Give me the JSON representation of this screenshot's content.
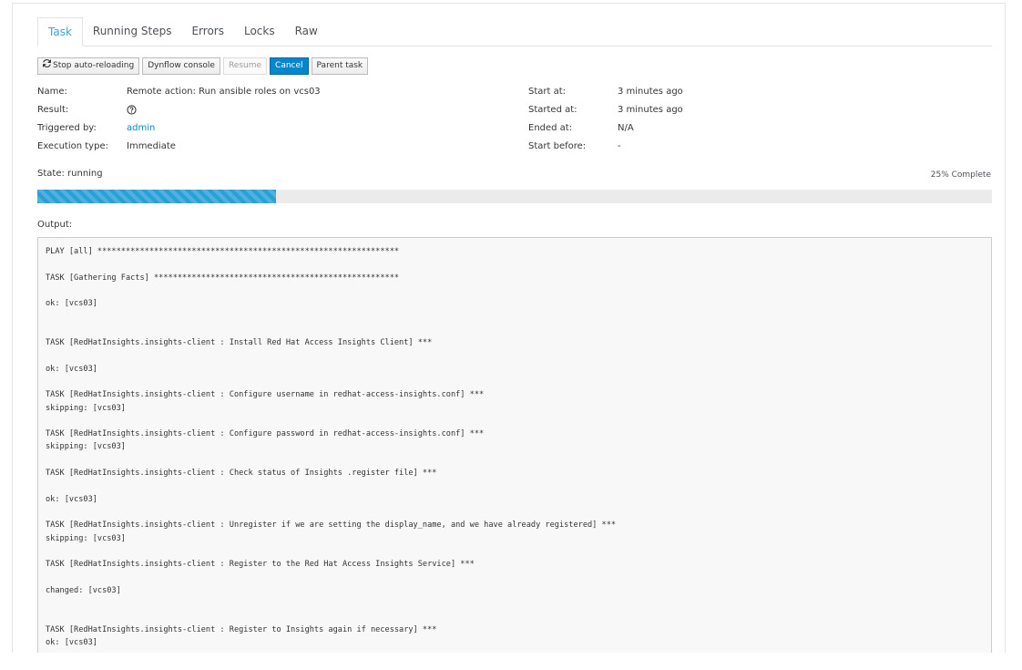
{
  "tabs": [
    {
      "label": "Task",
      "active": true
    },
    {
      "label": "Running Steps",
      "active": false
    },
    {
      "label": "Errors",
      "active": false
    },
    {
      "label": "Locks",
      "active": false
    },
    {
      "label": "Raw",
      "active": false
    }
  ],
  "toolbar": {
    "stop_auto_reloading": {
      "label": "Stop auto-reloading",
      "icon": "refresh-icon"
    },
    "dynflow_console": {
      "label": "Dynflow console"
    },
    "resume": {
      "label": "Resume",
      "disabled": true
    },
    "cancel": {
      "label": "Cancel",
      "primary": true
    },
    "parent_task": {
      "label": "Parent task"
    }
  },
  "details_left": {
    "name": {
      "label": "Name:",
      "value": "Remote action: Run ansible roles on vcs03"
    },
    "result": {
      "label": "Result:",
      "icon": "question-circle-icon"
    },
    "triggered_by": {
      "label": "Triggered by:",
      "value": "admin"
    },
    "execution_type": {
      "label": "Execution type:",
      "value": "Immediate"
    }
  },
  "details_right": {
    "start_at": {
      "label": "Start at:",
      "value": "3 minutes ago"
    },
    "started_at": {
      "label": "Started at:",
      "value": "3 minutes ago"
    },
    "ended_at": {
      "label": "Ended at:",
      "value": "N/A"
    },
    "start_before": {
      "label": "Start before:",
      "value": "-"
    }
  },
  "state": {
    "label": "State:",
    "value": "running"
  },
  "progress": {
    "percent": 25,
    "text": "25% Complete"
  },
  "colors": {
    "accent": "#0088ce",
    "progress_fill": "#2aa0d9",
    "tab_active": "#39a5dc"
  },
  "output": {
    "label": "Output:",
    "text": "PLAY [all] ****************************************************************\n\nTASK [Gathering Facts] ****************************************************\n\nok: [vcs03]\n\n\nTASK [RedHatInsights.insights-client : Install Red Hat Access Insights Client] ***\n\nok: [vcs03]\n\nTASK [RedHatInsights.insights-client : Configure username in redhat-access-insights.conf] ***\nskipping: [vcs03]\n\nTASK [RedHatInsights.insights-client : Configure password in redhat-access-insights.conf] ***\nskipping: [vcs03]\n\nTASK [RedHatInsights.insights-client : Check status of Insights .register file] ***\n\nok: [vcs03]\n\nTASK [RedHatInsights.insights-client : Unregister if we are setting the display_name, and we have already registered] ***\nskipping: [vcs03]\n\nTASK [RedHatInsights.insights-client : Register to the Red Hat Access Insights Service] ***\n\nchanged: [vcs03]\n\n\nTASK [RedHatInsights.insights-client : Register to Insights again if necessary] ***\nok: [vcs03]"
  }
}
